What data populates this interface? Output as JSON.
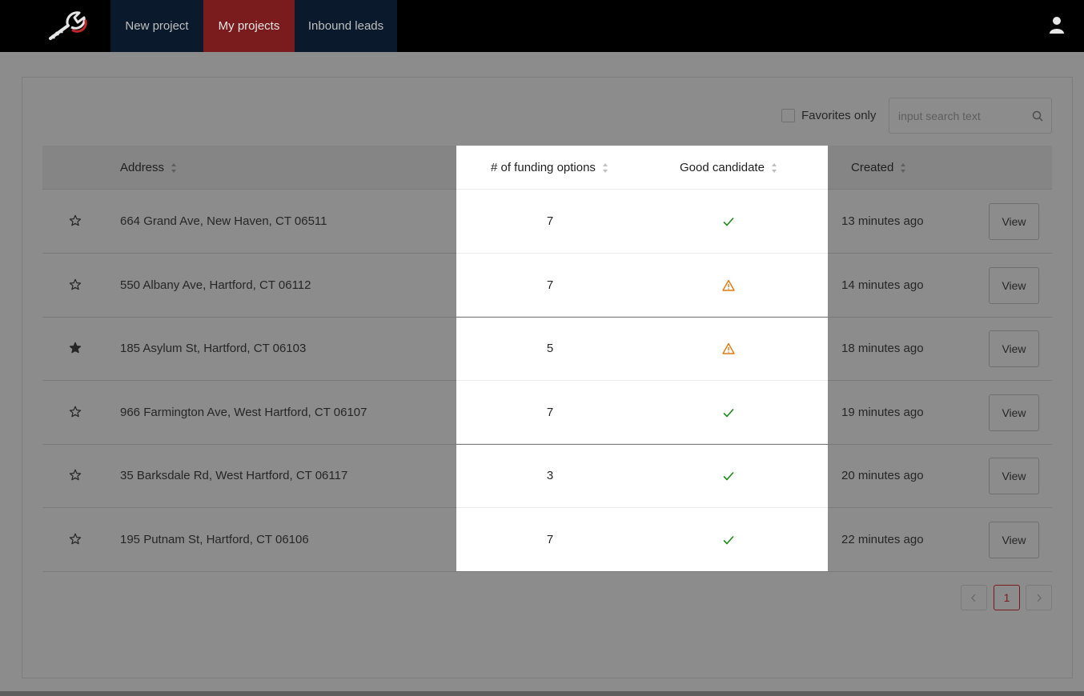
{
  "nav": {
    "items": [
      {
        "label": "New project"
      },
      {
        "label": "My projects"
      },
      {
        "label": "Inbound leads"
      }
    ],
    "active": "My projects",
    "colors": {
      "bar": "#000000",
      "tab": "#0a1a2c",
      "active_tab": "#7a1c1d"
    }
  },
  "toolbar": {
    "favorites_label": "Favorites only",
    "favorites_checked": false,
    "search_placeholder": "input search text",
    "search_value": ""
  },
  "table": {
    "headers": {
      "address": "Address",
      "funding": "# of funding options",
      "good": "Good candidate",
      "created": "Created"
    },
    "view_label": "View",
    "rows": [
      {
        "favorite": false,
        "address": "664 Grand Ave, New Haven, CT 06511",
        "funding": "7",
        "good_status": "check",
        "created": "13 minutes ago"
      },
      {
        "favorite": false,
        "address": "550 Albany Ave, Hartford, CT 06112",
        "funding": "7",
        "good_status": "warning",
        "created": "14 minutes ago"
      },
      {
        "favorite": true,
        "address": "185 Asylum St, Hartford, CT 06103",
        "funding": "5",
        "good_status": "warning",
        "created": "18 minutes ago"
      },
      {
        "favorite": false,
        "address": "966 Farmington Ave, West Hartford, CT 06107",
        "funding": "7",
        "good_status": "check",
        "created": "19 minutes ago"
      },
      {
        "favorite": false,
        "address": "35 Barksdale Rd, West Hartford, CT 06117",
        "funding": "3",
        "good_status": "check",
        "created": "20 minutes ago"
      },
      {
        "favorite": false,
        "address": "195 Putnam St, Hartford, CT 06106",
        "funding": "7",
        "good_status": "check",
        "created": "22 minutes ago"
      }
    ],
    "status_colors": {
      "check": "#1a8a1a",
      "warning": "#e07a10"
    }
  },
  "pagination": {
    "current": "1"
  }
}
